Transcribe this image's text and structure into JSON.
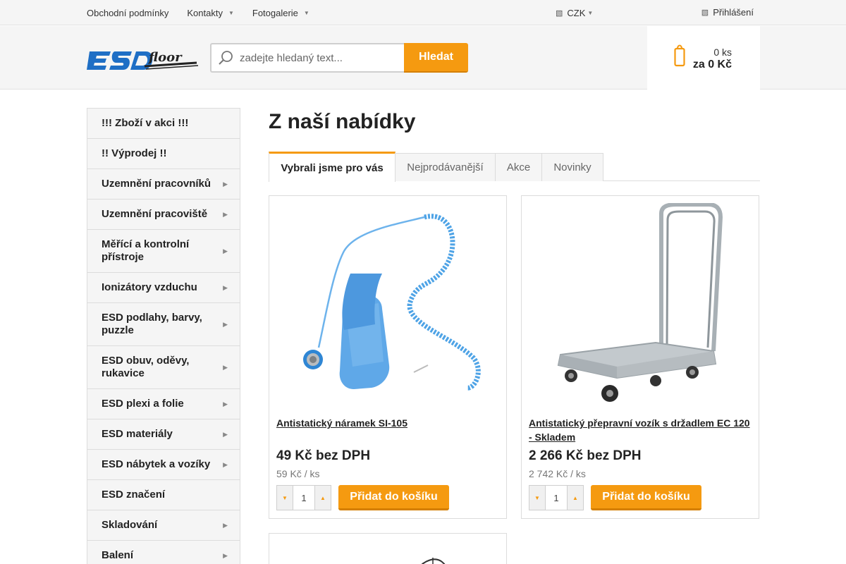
{
  "topbar": {
    "links": [
      {
        "label": "Obchodní podmínky",
        "has_caret": false
      },
      {
        "label": "Kontakty",
        "has_caret": true
      },
      {
        "label": "Fotogalerie",
        "has_caret": true
      }
    ],
    "currency": "CZK",
    "login": "Přihlášení"
  },
  "header": {
    "logo_icon": "esd-floor-logo",
    "search_placeholder": "zadejte hledaný text...",
    "search_button": "Hledat",
    "cart_count": "0 ks",
    "cart_price": "za 0 Kč"
  },
  "sidebar": {
    "items": [
      {
        "label": "!!! Zboží v akci !!!",
        "submenu": false
      },
      {
        "label": "!! Výprodej !!",
        "submenu": false
      },
      {
        "label": "Uzemnění pracovníků",
        "submenu": true
      },
      {
        "label": "Uzemnění pracoviště",
        "submenu": true
      },
      {
        "label": "Měřící a kontrolní přístroje",
        "submenu": true
      },
      {
        "label": "Ionizátory vzduchu",
        "submenu": true
      },
      {
        "label": "ESD podlahy, barvy, puzzle",
        "submenu": true
      },
      {
        "label": "ESD obuv, oděvy, rukavice",
        "submenu": true
      },
      {
        "label": "ESD plexi a folie",
        "submenu": true
      },
      {
        "label": "ESD materiály",
        "submenu": true
      },
      {
        "label": "ESD nábytek a vozíky",
        "submenu": true
      },
      {
        "label": "ESD značení",
        "submenu": false
      },
      {
        "label": "Skladování",
        "submenu": true
      },
      {
        "label": "Balení",
        "submenu": true
      }
    ]
  },
  "main": {
    "title": "Z naší nabídky",
    "tabs": [
      {
        "label": "Vybrali jsme pro vás",
        "active": true
      },
      {
        "label": "Nejprodávanější",
        "active": false
      },
      {
        "label": "Akce",
        "active": false
      },
      {
        "label": "Novinky",
        "active": false
      }
    ],
    "products": [
      {
        "name": "Antistatický náramek SI-105",
        "price_ex_vat": "49 Kč bez DPH",
        "price_incl": "59 Kč / ks",
        "qty": "1",
        "add_label": "Přidat do košíku",
        "image_icon": "wrist-strap-image"
      },
      {
        "name": "Antistatický přepravní vozík s držadlem EC 120 - Skladem",
        "price_ex_vat": "2 266 Kč bez DPH",
        "price_incl": "2 742 Kč / ks",
        "qty": "1",
        "add_label": "Přidat do košíku",
        "image_icon": "transport-cart-image"
      }
    ]
  },
  "colors": {
    "accent": "#f59a10",
    "accent_dark": "#d47f00",
    "logo_blue": "#1f6fc5"
  }
}
